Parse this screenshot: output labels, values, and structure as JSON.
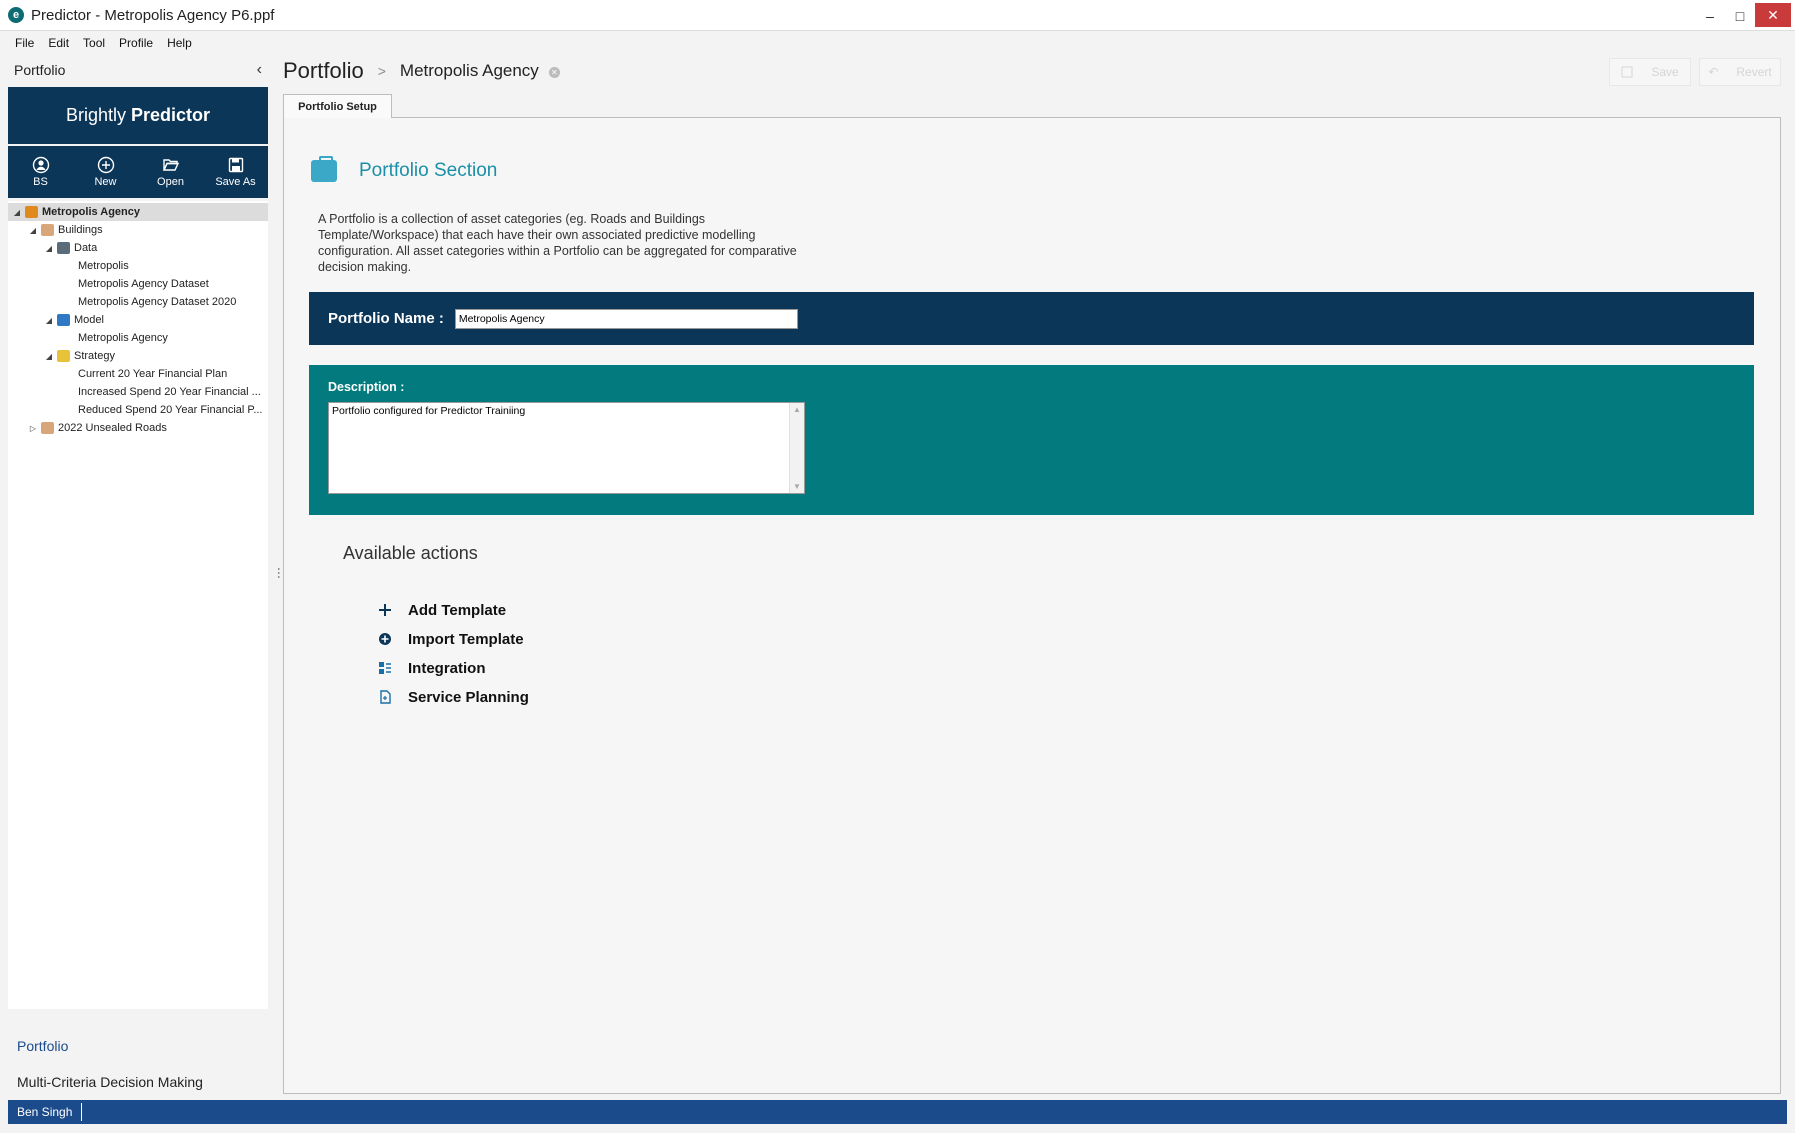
{
  "window": {
    "title": "Predictor - Metropolis Agency P6.ppf",
    "minimize": "–",
    "maximize": "□",
    "close": "✕"
  },
  "menu": [
    "File",
    "Edit",
    "Tool",
    "Profile",
    "Help"
  ],
  "left_panel": {
    "header": "Portfolio",
    "brand_light": "Brightly",
    "brand_bold": "Predictor",
    "toolbar": [
      {
        "label": "BS",
        "icon": "user-circle-icon"
      },
      {
        "label": "New",
        "icon": "plus-circle-icon"
      },
      {
        "label": "Open",
        "icon": "folder-open-icon"
      },
      {
        "label": "Save As",
        "icon": "floppy-disk-icon"
      }
    ],
    "tree": [
      {
        "label": "Metropolis Agency",
        "level": 0,
        "expand": "◢",
        "icon": "portfolio-icon",
        "selected": true
      },
      {
        "label": "Buildings",
        "level": 1,
        "expand": "◢",
        "icon": "template-icon"
      },
      {
        "label": "Data",
        "level": 2,
        "expand": "◢",
        "icon": "database-icon"
      },
      {
        "label": "Metropolis",
        "level": 3
      },
      {
        "label": "Metropolis Agency Dataset",
        "level": 3
      },
      {
        "label": "Metropolis Agency Dataset 2020",
        "level": 3
      },
      {
        "label": "Model",
        "level": 2,
        "expand": "◢",
        "icon": "chart-icon"
      },
      {
        "label": "Metropolis Agency",
        "level": 3
      },
      {
        "label": "Strategy",
        "level": 2,
        "expand": "◢",
        "icon": "coins-icon"
      },
      {
        "label": "Current 20 Year Financial Plan",
        "level": 3
      },
      {
        "label": "Increased Spend 20 Year Financial ...",
        "level": 3
      },
      {
        "label": "Reduced Spend 20 Year Financial P...",
        "level": 3
      },
      {
        "label": "2022 Unsealed Roads",
        "level": 1,
        "expand": "▷",
        "icon": "template-icon"
      }
    ],
    "nav": [
      {
        "label": "Portfolio",
        "active": true
      },
      {
        "label": "Multi-Criteria Decision Making",
        "active": false
      }
    ]
  },
  "breadcrumb": {
    "root": "Portfolio",
    "separator": ">",
    "current": "Metropolis Agency"
  },
  "top_actions": {
    "save": "Save",
    "revert": "Revert"
  },
  "tab": "Portfolio Setup",
  "section": {
    "title": "Portfolio Section",
    "description": "A Portfolio is a collection of asset categories (eg. Roads and Buildings Template/Workspace) that each have their own associated predictive modelling configuration. All asset categories within a Portfolio can be aggregated for comparative decision making."
  },
  "form": {
    "name_label": "Portfolio Name :",
    "name_value": "Metropolis Agency",
    "description_label": "Description :",
    "description_value": "Portfolio configured for Predictor Trainiing"
  },
  "actions": {
    "title": "Available actions",
    "items": [
      {
        "label": "Add Template",
        "icon": "plus-icon"
      },
      {
        "label": "Import Template",
        "icon": "import-circle-icon"
      },
      {
        "label": "Integration",
        "icon": "integration-icon"
      },
      {
        "label": "Service Planning",
        "icon": "document-icon"
      }
    ]
  },
  "status": {
    "user": "Ben Singh"
  },
  "colors": {
    "navy": "#0c3658",
    "teal": "#027a7e",
    "accent": "#1b8fa8",
    "status_blue": "#1c4b8c"
  }
}
